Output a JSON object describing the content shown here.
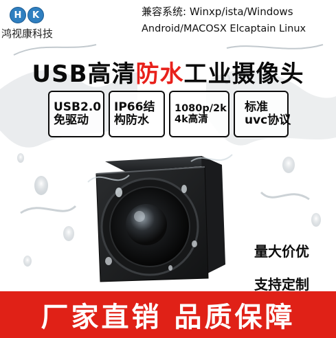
{
  "logo": {
    "letter_left": "H",
    "letter_right": "K",
    "color": "#2f7fc0"
  },
  "company": {
    "name": "鸿视康科技"
  },
  "compat": {
    "line1": "兼容系统: Winxp/ista/Windows",
    "line2": "Android/MACOSX Elcaptain Linux"
  },
  "title": {
    "part1": "USB高清",
    "part2": "防水",
    "part3": "工业摄像头",
    "accent_color": "#e8211b"
  },
  "features": [
    {
      "line1": "USB2.0",
      "line2": "免驱动"
    },
    {
      "line1": "IP66结",
      "line2": "构防水"
    },
    {
      "line1": "1080p/2k",
      "line2": "4k高清"
    },
    {
      "line1": "标准",
      "line2": "uvc协议"
    }
  ],
  "side": {
    "line1": "量大价优",
    "line2": "支持定制"
  },
  "banner": {
    "text": "厂家直销 品质保障",
    "color": "#e02117"
  }
}
